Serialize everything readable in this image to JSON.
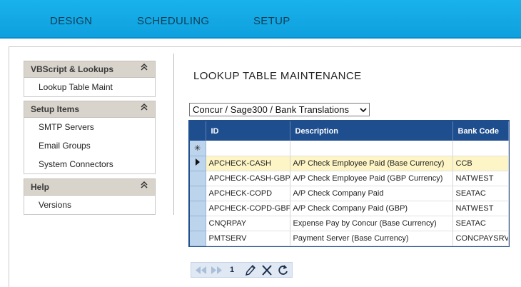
{
  "nav": {
    "tabs": [
      {
        "label": "DESIGN"
      },
      {
        "label": "SCHEDULING"
      },
      {
        "label": "SETUP"
      }
    ]
  },
  "sidebar": {
    "sections": [
      {
        "title": "VBScript & Lookups",
        "items": [
          "Lookup Table Maint"
        ]
      },
      {
        "title": "Setup Items",
        "items": [
          "SMTP Servers",
          "Email Groups",
          "System Connectors"
        ]
      },
      {
        "title": "Help",
        "items": [
          "Versions"
        ]
      }
    ],
    "collapse_glyph": "⌃⌃"
  },
  "main": {
    "title": "LOOKUP TABLE MAINTENANCE",
    "table_select": "Concur / Sage300 / Bank Translations"
  },
  "grid": {
    "columns": [
      "ID",
      "Description",
      "Bank Code"
    ],
    "new_row_glyph": "✳",
    "rows": [
      {
        "id": "APCHECK-CASH",
        "description": "A/P Check Employee Paid (Base Currency)",
        "bank_code": "CCB"
      },
      {
        "id": "APCHECK-CASH-GBP",
        "description": "A/P Check Employee Paid (GBP Currency)",
        "bank_code": "NATWEST"
      },
      {
        "id": "APCHECK-COPD",
        "description": "A/P Check Company Paid",
        "bank_code": "SEATAC"
      },
      {
        "id": "APCHECK-COPD-GBP",
        "description": "A/P Check Company Paid (GBP)",
        "bank_code": "NATWEST"
      },
      {
        "id": "CNQRPAY",
        "description": "Expense Pay by Concur (Base Currency)",
        "bank_code": "SEATAC"
      },
      {
        "id": "PMTSERV",
        "description": "Payment Server (Base Currency)",
        "bank_code": "CONCPAYSRV"
      }
    ]
  },
  "pager": {
    "page": "1",
    "icons": [
      "first-page-icon",
      "next-page-icon",
      "edit-icon",
      "delete-icon",
      "refresh-icon"
    ]
  },
  "colors": {
    "nav": "#13a9e8",
    "grid_header": "#1f4e8f",
    "current_row": "#fdf5c6",
    "selector_col": "#bcd4ec"
  }
}
